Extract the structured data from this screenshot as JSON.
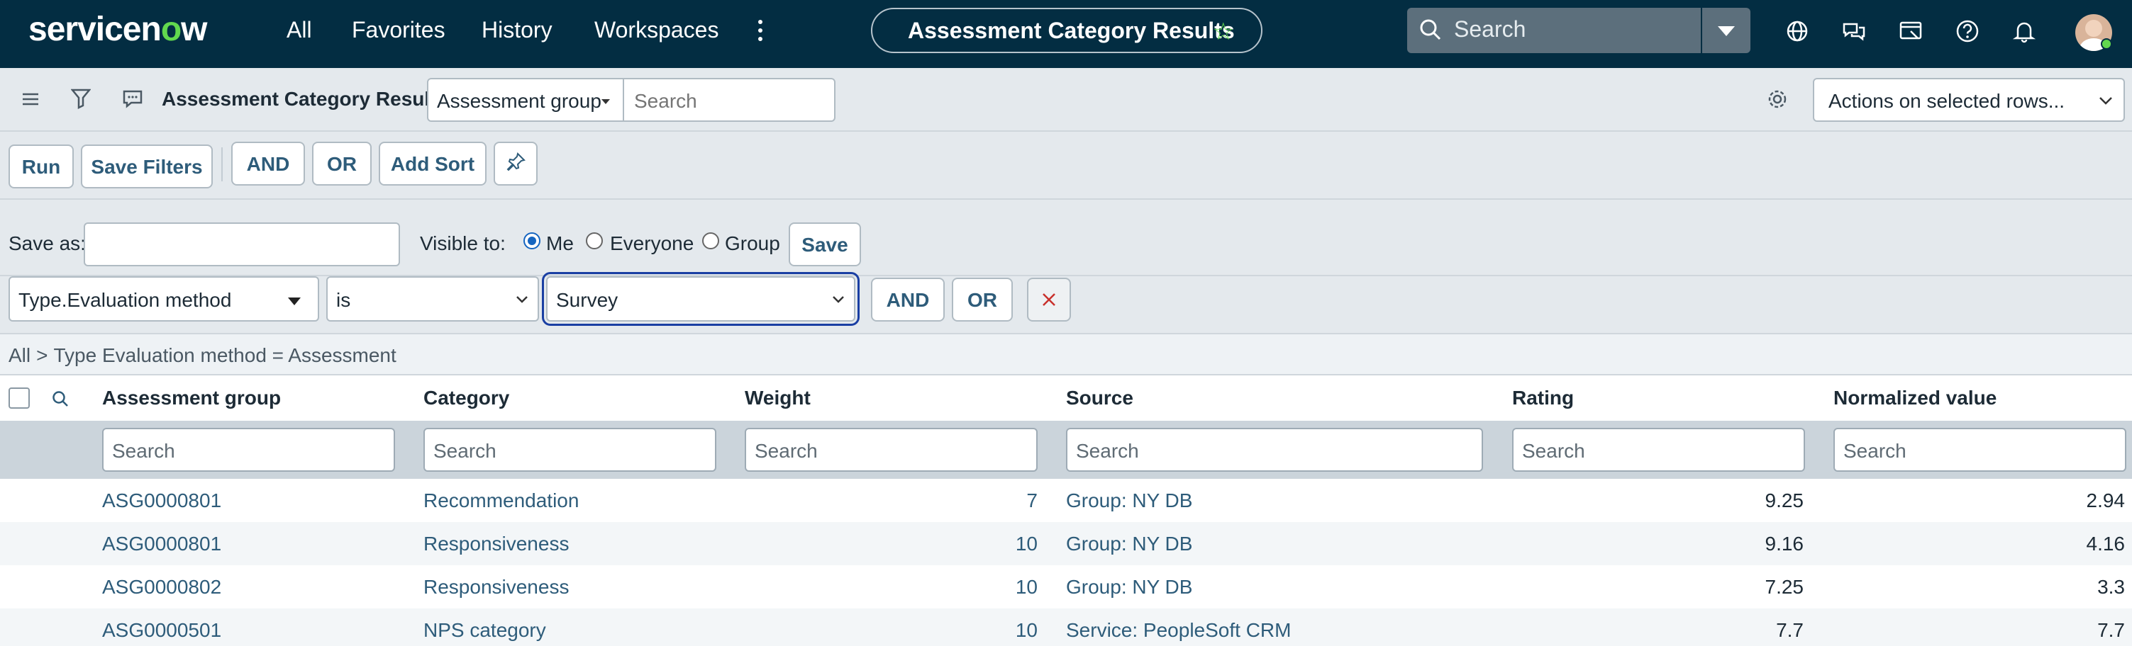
{
  "nav": {
    "logo_prefix": "servicen",
    "logo_o": "o",
    "logo_suffix": "w",
    "items": [
      "All",
      "Favorites",
      "History",
      "Workspaces"
    ],
    "more_icon": "vertical-ellipsis-icon",
    "page_title": "Assessment Category Results",
    "favorite_icon": "star-outline-icon",
    "search_placeholder": "Search",
    "icons": [
      "globe-icon",
      "chat-icon",
      "connect-icon",
      "help-icon",
      "bell-icon"
    ],
    "accent": "#62d84e",
    "bg": "#032d42"
  },
  "listbar": {
    "title": "Assessment Category Results",
    "group_select": "Assessment group",
    "search_placeholder": "Search",
    "actions": "Actions on selected rows..."
  },
  "filterbar": {
    "run": "Run",
    "save_filters": "Save Filters",
    "and": "AND",
    "or": "OR",
    "add_sort": "Add Sort"
  },
  "save_row": {
    "save_as_label": "Save as:",
    "save_as_value": "",
    "visible_to_label": "Visible to:",
    "options": [
      "Me",
      "Everyone",
      "Group"
    ],
    "selected": "Me",
    "save": "Save"
  },
  "condition": {
    "field": "Type.Evaluation method",
    "operator": "is",
    "value": "Survey",
    "and": "AND",
    "or": "OR"
  },
  "breadcrumb": {
    "root": "All",
    "separator": ">",
    "condition": "Type Evaluation method = Assessment"
  },
  "table": {
    "columns": [
      "Assessment group",
      "Category",
      "Weight",
      "Source",
      "Rating",
      "Normalized value"
    ],
    "search_placeholder": "Search",
    "rows": [
      {
        "group": "ASG0000801",
        "category": "Recommendation",
        "weight": "7",
        "source": "Group: NY DB",
        "rating": "9.25",
        "normalized": "2.94"
      },
      {
        "group": "ASG0000801",
        "category": "Responsiveness",
        "weight": "10",
        "source": "Group: NY DB",
        "rating": "9.16",
        "normalized": "4.16"
      },
      {
        "group": "ASG0000802",
        "category": "Responsiveness",
        "weight": "10",
        "source": "Group: NY DB",
        "rating": "7.25",
        "normalized": "3.3"
      },
      {
        "group": "ASG0000501",
        "category": "NPS category",
        "weight": "10",
        "source": "Service: PeopleSoft CRM",
        "rating": "7.7",
        "normalized": "7.7"
      }
    ]
  }
}
